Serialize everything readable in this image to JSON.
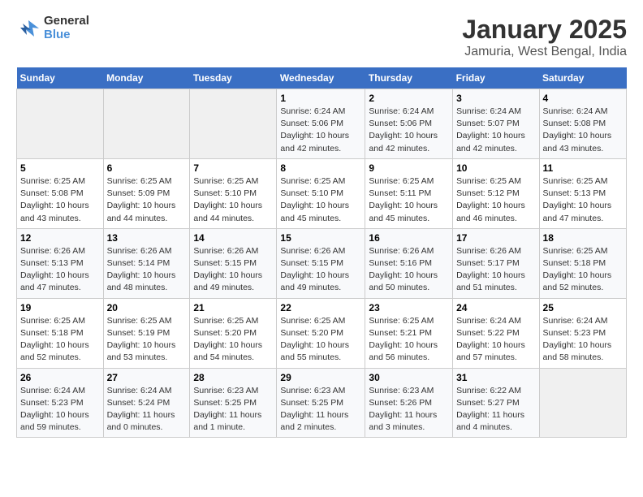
{
  "logo": {
    "line1": "General",
    "line2": "Blue"
  },
  "title": "January 2025",
  "subtitle": "Jamuria, West Bengal, India",
  "days_of_week": [
    "Sunday",
    "Monday",
    "Tuesday",
    "Wednesday",
    "Thursday",
    "Friday",
    "Saturday"
  ],
  "weeks": [
    [
      {
        "day": "",
        "info": ""
      },
      {
        "day": "",
        "info": ""
      },
      {
        "day": "",
        "info": ""
      },
      {
        "day": "1",
        "info": "Sunrise: 6:24 AM\nSunset: 5:06 PM\nDaylight: 10 hours\nand 42 minutes."
      },
      {
        "day": "2",
        "info": "Sunrise: 6:24 AM\nSunset: 5:06 PM\nDaylight: 10 hours\nand 42 minutes."
      },
      {
        "day": "3",
        "info": "Sunrise: 6:24 AM\nSunset: 5:07 PM\nDaylight: 10 hours\nand 42 minutes."
      },
      {
        "day": "4",
        "info": "Sunrise: 6:24 AM\nSunset: 5:08 PM\nDaylight: 10 hours\nand 43 minutes."
      }
    ],
    [
      {
        "day": "5",
        "info": "Sunrise: 6:25 AM\nSunset: 5:08 PM\nDaylight: 10 hours\nand 43 minutes."
      },
      {
        "day": "6",
        "info": "Sunrise: 6:25 AM\nSunset: 5:09 PM\nDaylight: 10 hours\nand 44 minutes."
      },
      {
        "day": "7",
        "info": "Sunrise: 6:25 AM\nSunset: 5:10 PM\nDaylight: 10 hours\nand 44 minutes."
      },
      {
        "day": "8",
        "info": "Sunrise: 6:25 AM\nSunset: 5:10 PM\nDaylight: 10 hours\nand 45 minutes."
      },
      {
        "day": "9",
        "info": "Sunrise: 6:25 AM\nSunset: 5:11 PM\nDaylight: 10 hours\nand 45 minutes."
      },
      {
        "day": "10",
        "info": "Sunrise: 6:25 AM\nSunset: 5:12 PM\nDaylight: 10 hours\nand 46 minutes."
      },
      {
        "day": "11",
        "info": "Sunrise: 6:25 AM\nSunset: 5:13 PM\nDaylight: 10 hours\nand 47 minutes."
      }
    ],
    [
      {
        "day": "12",
        "info": "Sunrise: 6:26 AM\nSunset: 5:13 PM\nDaylight: 10 hours\nand 47 minutes."
      },
      {
        "day": "13",
        "info": "Sunrise: 6:26 AM\nSunset: 5:14 PM\nDaylight: 10 hours\nand 48 minutes."
      },
      {
        "day": "14",
        "info": "Sunrise: 6:26 AM\nSunset: 5:15 PM\nDaylight: 10 hours\nand 49 minutes."
      },
      {
        "day": "15",
        "info": "Sunrise: 6:26 AM\nSunset: 5:15 PM\nDaylight: 10 hours\nand 49 minutes."
      },
      {
        "day": "16",
        "info": "Sunrise: 6:26 AM\nSunset: 5:16 PM\nDaylight: 10 hours\nand 50 minutes."
      },
      {
        "day": "17",
        "info": "Sunrise: 6:26 AM\nSunset: 5:17 PM\nDaylight: 10 hours\nand 51 minutes."
      },
      {
        "day": "18",
        "info": "Sunrise: 6:25 AM\nSunset: 5:18 PM\nDaylight: 10 hours\nand 52 minutes."
      }
    ],
    [
      {
        "day": "19",
        "info": "Sunrise: 6:25 AM\nSunset: 5:18 PM\nDaylight: 10 hours\nand 52 minutes."
      },
      {
        "day": "20",
        "info": "Sunrise: 6:25 AM\nSunset: 5:19 PM\nDaylight: 10 hours\nand 53 minutes."
      },
      {
        "day": "21",
        "info": "Sunrise: 6:25 AM\nSunset: 5:20 PM\nDaylight: 10 hours\nand 54 minutes."
      },
      {
        "day": "22",
        "info": "Sunrise: 6:25 AM\nSunset: 5:20 PM\nDaylight: 10 hours\nand 55 minutes."
      },
      {
        "day": "23",
        "info": "Sunrise: 6:25 AM\nSunset: 5:21 PM\nDaylight: 10 hours\nand 56 minutes."
      },
      {
        "day": "24",
        "info": "Sunrise: 6:24 AM\nSunset: 5:22 PM\nDaylight: 10 hours\nand 57 minutes."
      },
      {
        "day": "25",
        "info": "Sunrise: 6:24 AM\nSunset: 5:23 PM\nDaylight: 10 hours\nand 58 minutes."
      }
    ],
    [
      {
        "day": "26",
        "info": "Sunrise: 6:24 AM\nSunset: 5:23 PM\nDaylight: 10 hours\nand 59 minutes."
      },
      {
        "day": "27",
        "info": "Sunrise: 6:24 AM\nSunset: 5:24 PM\nDaylight: 11 hours\nand 0 minutes."
      },
      {
        "day": "28",
        "info": "Sunrise: 6:23 AM\nSunset: 5:25 PM\nDaylight: 11 hours\nand 1 minute."
      },
      {
        "day": "29",
        "info": "Sunrise: 6:23 AM\nSunset: 5:25 PM\nDaylight: 11 hours\nand 2 minutes."
      },
      {
        "day": "30",
        "info": "Sunrise: 6:23 AM\nSunset: 5:26 PM\nDaylight: 11 hours\nand 3 minutes."
      },
      {
        "day": "31",
        "info": "Sunrise: 6:22 AM\nSunset: 5:27 PM\nDaylight: 11 hours\nand 4 minutes."
      },
      {
        "day": "",
        "info": ""
      }
    ]
  ]
}
